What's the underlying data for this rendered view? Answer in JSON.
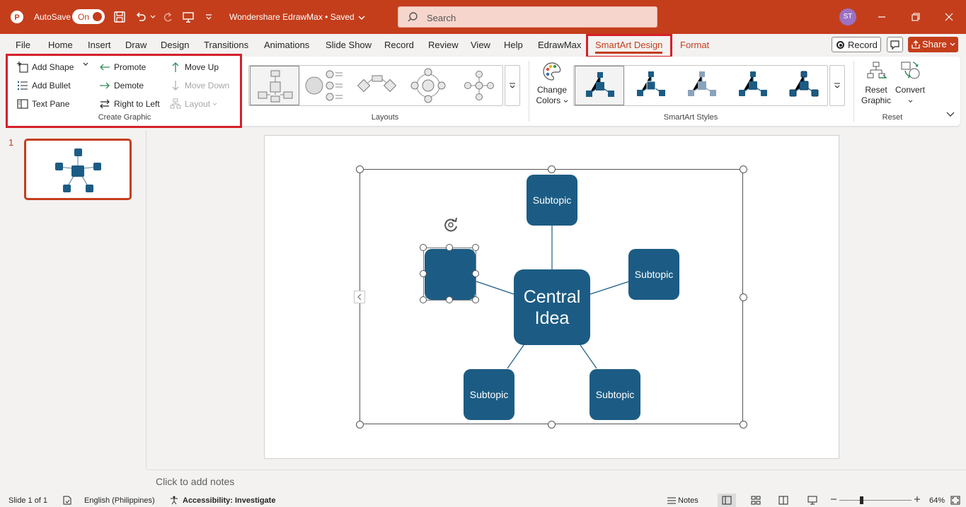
{
  "colors": {
    "brand": "#c43e1c",
    "node_fill": "#1c5c84",
    "highlight_box": "#d6202a"
  },
  "titlebar": {
    "autosave_label": "AutoSave",
    "autosave_state": "On",
    "document_title": "Wondershare EdrawMax • Saved",
    "search_placeholder": "Search",
    "user_initials": "ST"
  },
  "tabs": [
    "File",
    "Home",
    "Insert",
    "Draw",
    "Design",
    "Transitions",
    "Animations",
    "Slide Show",
    "Record",
    "Review",
    "View",
    "Help",
    "EdrawMax",
    "SmartArt Design",
    "Format"
  ],
  "active_tab": "SmartArt Design",
  "top_right": {
    "record_label": "Record",
    "share_label": "Share"
  },
  "ribbon": {
    "create_graphic": {
      "add_shape": "Add Shape",
      "add_bullet": "Add Bullet",
      "text_pane": "Text Pane",
      "promote": "Promote",
      "demote": "Demote",
      "right_to_left": "Right to Left",
      "move_up": "Move Up",
      "move_down": "Move Down",
      "layout": "Layout",
      "group_label": "Create Graphic"
    },
    "layouts": {
      "group_label": "Layouts"
    },
    "smartart_styles": {
      "change_colors_line1": "Change",
      "change_colors_line2": "Colors",
      "group_label": "SmartArt Styles"
    },
    "reset": {
      "reset_graphic_line1": "Reset",
      "reset_graphic_line2": "Graphic",
      "convert": "Convert",
      "group_label": "Reset"
    }
  },
  "slide_panel": {
    "slide_number": "1"
  },
  "diagram": {
    "central": "Central Idea",
    "top": "Subtopic",
    "right": "Subtopic",
    "bottom_left": "Subtopic",
    "bottom_right": "Subtopic",
    "left": ""
  },
  "notes_placeholder": "Click to add notes",
  "statusbar": {
    "slide_info": "Slide 1 of 1",
    "language": "English (Philippines)",
    "accessibility": "Accessibility: Investigate",
    "notes_label": "Notes",
    "zoom": "64%"
  }
}
